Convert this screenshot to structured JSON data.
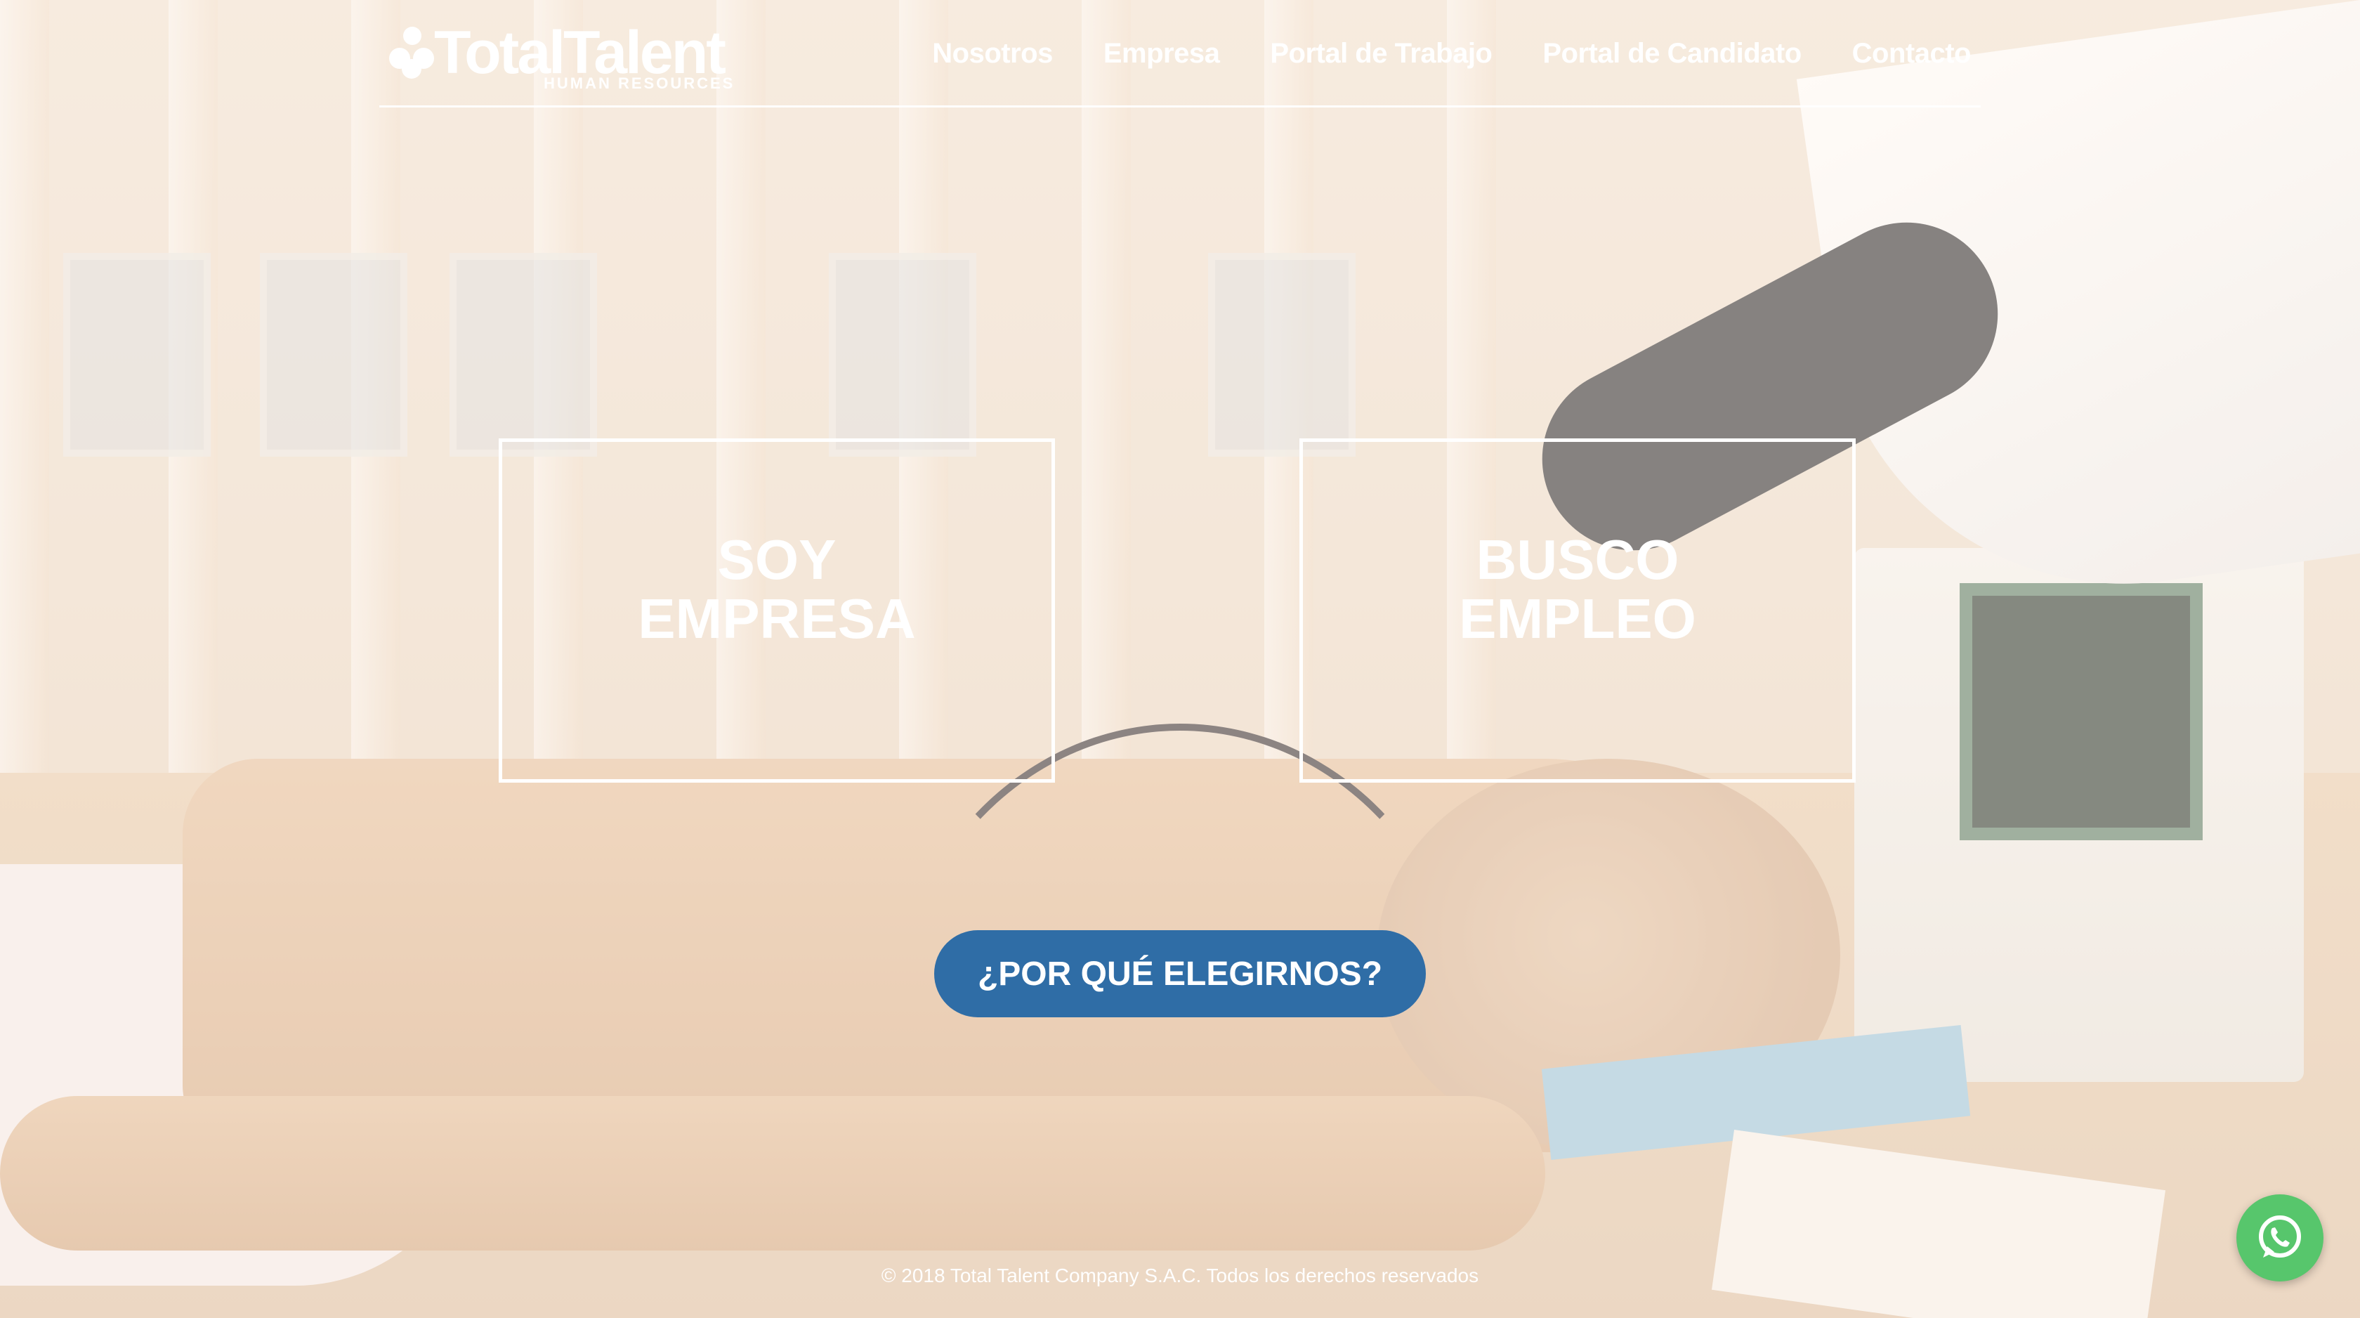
{
  "brand": {
    "name": "TotalTalent",
    "tagline": "HUMAN RESOURCES"
  },
  "nav": {
    "items": [
      "Nosotros",
      "Empresa",
      "Portal de Trabajo",
      "Portal de Candidato",
      "Contacto"
    ]
  },
  "cards": {
    "left": "SOY EMPRESA",
    "right": "BUSCO EMPLEO"
  },
  "cta": {
    "label": "¿POR QUÉ ELEGIRNOS?"
  },
  "footer": {
    "text": "© 2018 Total Talent Company S.A.C. Todos los derechos reservados"
  },
  "colors": {
    "cta": "#2f6da6",
    "whatsapp": "#57c66c",
    "text": "#ffffff"
  },
  "icons": {
    "whatsapp": "whatsapp-icon",
    "logo": "people-logo-icon"
  }
}
